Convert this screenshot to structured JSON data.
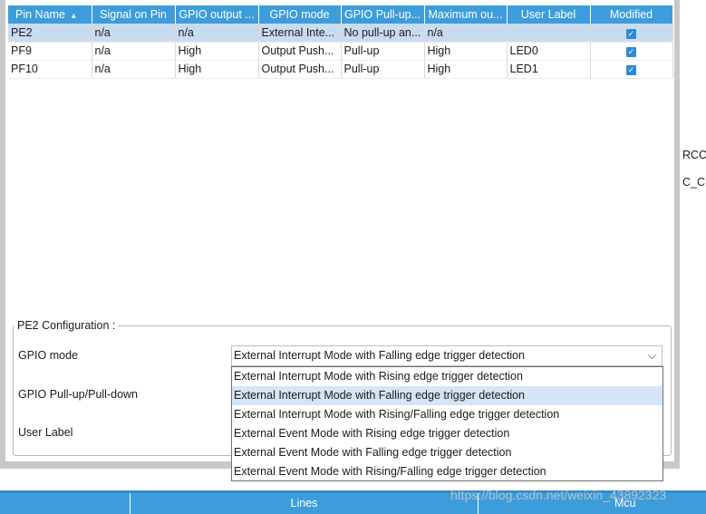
{
  "table": {
    "headers": [
      "Pin Name",
      "Signal on Pin",
      "GPIO output ...",
      "GPIO mode",
      "GPIO Pull-up...",
      "Maximum ou...",
      "User Label",
      "Modified"
    ],
    "rows": [
      [
        "PE2",
        "n/a",
        "n/a",
        "External Inte...",
        "No pull-up an...",
        "n/a",
        "",
        true
      ],
      [
        "PF9",
        "n/a",
        "High",
        "Output Push...",
        "Pull-up",
        "High",
        "LED0",
        true
      ],
      [
        "PF10",
        "n/a",
        "High",
        "Output Push...",
        "Pull-up",
        "High",
        "LED1",
        true
      ]
    ],
    "selected_row": 0,
    "sort_column": "Pin Name"
  },
  "right_panel": {
    "cut_text_1": "RCC",
    "cut_text_2": "C_C"
  },
  "config": {
    "title": "PE2 Configuration :",
    "gpio_mode_label": "GPIO mode",
    "pull_label": "GPIO Pull-up/Pull-down",
    "user_label_label": "User Label",
    "gpio_mode_value": "External Interrupt Mode with Falling edge trigger detection",
    "dropdown_options": [
      "External Interrupt Mode with Rising edge trigger detection",
      "External Interrupt Mode with Falling edge trigger detection",
      "External Interrupt Mode with Rising/Falling edge trigger detection",
      "External Event Mode with Rising edge trigger detection",
      "External Event Mode with Falling edge trigger detection",
      "External Event Mode with Rising/Falling edge trigger detection"
    ],
    "highlighted_option": 1
  },
  "bottom_bar": {
    "lines_label": "Lines",
    "mcu_label": "Mcu"
  },
  "watermark": "https://blog.csdn.net/weixin_43892323",
  "colors": {
    "header_blue": "#3d9ddb",
    "selected_row": "#c9dcef",
    "highlight_option": "#d4e5f5"
  }
}
